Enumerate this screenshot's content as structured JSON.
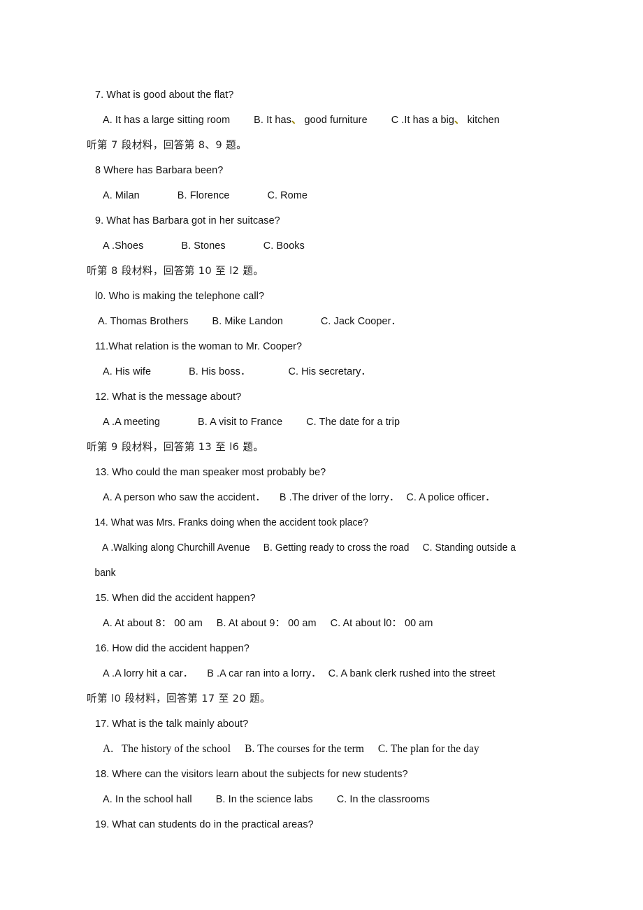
{
  "document": {
    "type": "listening-comprehension-exam-paper",
    "language_mix": "English with Chinese instructions",
    "page_background": "#ffffff",
    "text_color": "#121212",
    "artifact_mark_color": "#9a8500"
  },
  "lines": {
    "q7_stem": "7. What is good about the flat?",
    "q7_opt_a": "A. It has a large sitting room",
    "q7_opt_b_pre": "B. It has",
    "q7_opt_b_mark": "、",
    "q7_opt_b_post": " good furniture",
    "q7_opt_c_pre": "C .It has a big",
    "q7_opt_c_mark": "、",
    "q7_opt_c_post": " kitchen",
    "cn_section_7": "听第 7 段材料，回答第 8、9 题。",
    "q8_stem": "8 Where has Barbara been?",
    "q8_opt_a": "A. Milan",
    "q8_opt_b": "B. Florence",
    "q8_opt_c": "C. Rome",
    "q9_stem": "9. What has Barbara got in her suitcase?",
    "q9_opt_a": "A .Shoes",
    "q9_opt_b": "B. Stones",
    "q9_opt_c": "C. Books",
    "cn_section_8": "听第 8 段材料，回答第 10 至 l2 题。",
    "q10_stem": "l0. Who is making the telephone call?",
    "q10_opt_a": "A. Thomas Brothers",
    "q10_opt_b": "B. Mike Landon",
    "q10_opt_c": "C. Jack Cooper．",
    "q11_stem": "11.What relation is the woman to Mr. Cooper?",
    "q11_opt_a": "A. His wife",
    "q11_opt_b": "B. His boss．",
    "q11_opt_c": "C. His secretary．",
    "q12_stem": "12. What is the message about?",
    "q12_opt_a": "A .A meeting",
    "q12_opt_b": "B. A visit to France",
    "q12_opt_c": "C. The date for a trip",
    "cn_section_9": "听第 9 段材料，回答第 13 至 l6 题。",
    "q13_stem": "13. Who could the man speaker most probably be?",
    "q13_opt_a": "A. A person who saw the accident．",
    "q13_opt_b": "B .The driver of the lorry．",
    "q13_opt_c": "C. A police officer．",
    "q14_stem": "14. What was Mrs. Franks doing when the accident took place?",
    "q14_opt_a": "A .Walking along Churchill Avenue",
    "q14_opt_b": "B. Getting ready to cross the road",
    "q14_opt_c": "C. Standing outside a",
    "q14_wrap": "bank",
    "q15_stem": "15. When did the accident happen?",
    "q15_opt_a": "A. At about 8： 00 am",
    "q15_opt_b": "B. At about 9： 00 am",
    "q15_opt_c": "C. At about l0： 00 am",
    "q16_stem": "16. How did the accident happen?",
    "q16_opt_a": "A .A lorry hit a car．",
    "q16_opt_b": "B .A car ran into a lorry．",
    "q16_opt_c": "C. A bank clerk rushed into the street",
    "cn_section_10": "听第 l0 段材料，回答第 17 至 20 题。",
    "q17_stem": "17. What is the talk mainly about?",
    "q17_opt_a": "A.   The history of the school",
    "q17_opt_b": "B. The courses for the term",
    "q17_opt_c": "C. The plan for the day",
    "q18_stem": "18. Where can the visitors learn about the subjects for new students?",
    "q18_opt_a": "A. In the school hall",
    "q18_opt_b": "B. In the science labs",
    "q18_opt_c": "C. In the classrooms",
    "q19_stem": "19. What can students do in the practical areas?"
  }
}
